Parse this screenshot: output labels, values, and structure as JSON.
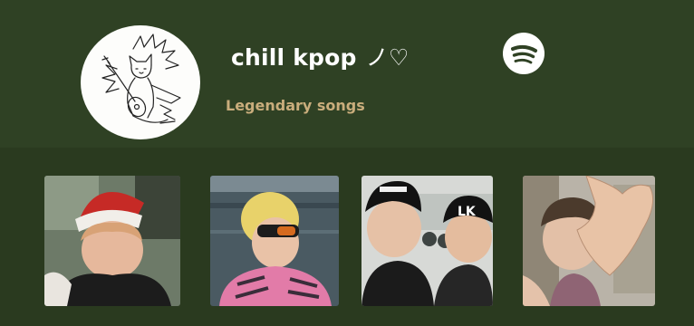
{
  "playlist": {
    "title": "chill kpop",
    "title_decoration": "ノ♡",
    "subtitle": "Legendary songs"
  },
  "icons": {
    "avatar": "cat-playing-guitar-sketch",
    "spotify": "spotify-logo-icon"
  },
  "photos": [
    {
      "name": "photo-santa-hat",
      "description_icon": "person-photo"
    },
    {
      "name": "photo-sunglasses",
      "description_icon": "person-photo"
    },
    {
      "name": "photo-two-friends-caps",
      "description_icon": "person-photo"
    },
    {
      "name": "photo-heart-hands",
      "description_icon": "person-photo"
    }
  ],
  "colors": {
    "header_bg": "#2f4124",
    "band_bg": "#2a3a1f",
    "title": "#ffffff",
    "subtitle": "#c9ad7c"
  }
}
